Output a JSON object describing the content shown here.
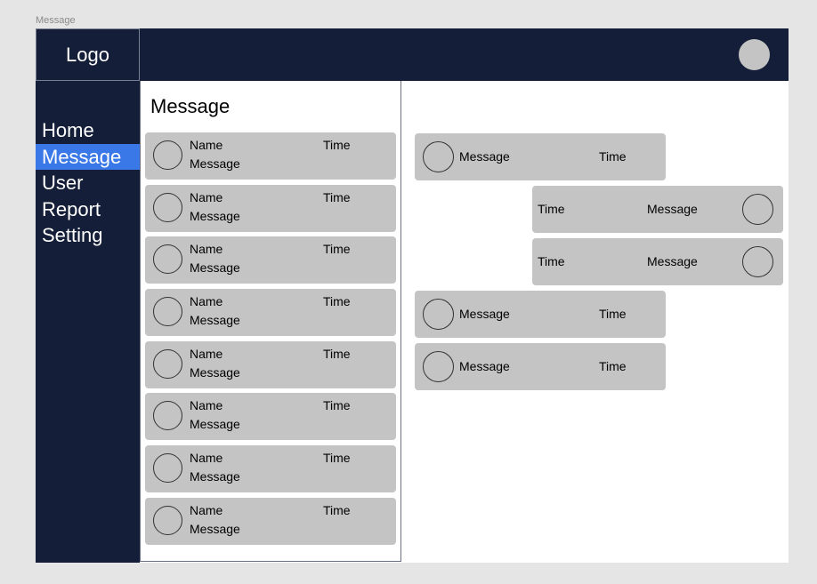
{
  "frame": {
    "label": "Message"
  },
  "header": {
    "logo": "Logo",
    "avatar_icon": "user-avatar-icon"
  },
  "sidebar": {
    "active_index": 1,
    "items": [
      {
        "label": "Home"
      },
      {
        "label": "Message"
      },
      {
        "label": "User"
      },
      {
        "label": "Report"
      },
      {
        "label": "Setting"
      }
    ]
  },
  "conversation_list": {
    "title": "Message",
    "items": [
      {
        "name": "Name",
        "message": "Message",
        "time": "Time"
      },
      {
        "name": "Name",
        "message": "Message",
        "time": "Time"
      },
      {
        "name": "Name",
        "message": "Message",
        "time": "Time"
      },
      {
        "name": "Name",
        "message": "Message",
        "time": "Time"
      },
      {
        "name": "Name",
        "message": "Message",
        "time": "Time"
      },
      {
        "name": "Name",
        "message": "Message",
        "time": "Time"
      },
      {
        "name": "Name",
        "message": "Message",
        "time": "Time"
      },
      {
        "name": "Name",
        "message": "Message",
        "time": "Time"
      }
    ]
  },
  "chat": {
    "messages": [
      {
        "direction": "incoming",
        "text": "Message",
        "time": "Time"
      },
      {
        "direction": "outgoing",
        "text": "Message",
        "time": "Time"
      },
      {
        "direction": "outgoing",
        "text": "Message",
        "time": "Time"
      },
      {
        "direction": "incoming",
        "text": "Message",
        "time": "Time"
      },
      {
        "direction": "incoming",
        "text": "Message",
        "time": "Time"
      }
    ]
  },
  "colors": {
    "background": "#e5e5e5",
    "navy": "#141e38",
    "accent": "#3b78e7",
    "card": "#c4c4c4",
    "surface": "#ffffff"
  }
}
